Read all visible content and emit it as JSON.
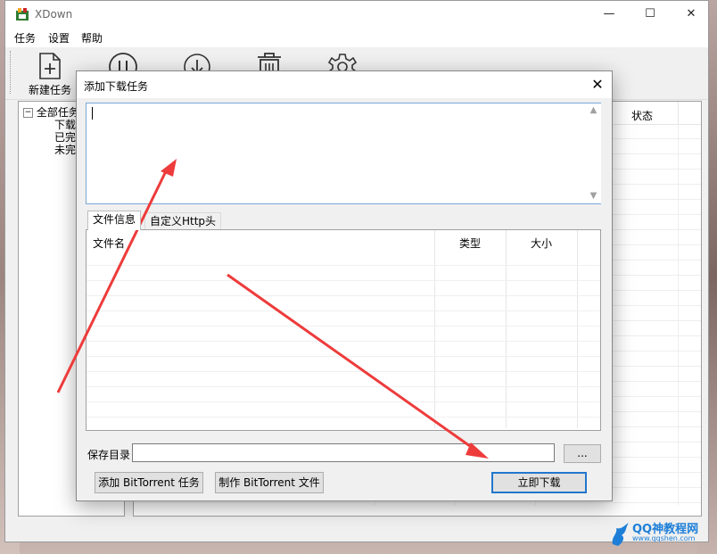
{
  "window": {
    "title": "XDown",
    "controls": {
      "minimize": "—",
      "maximize": "☐",
      "close": "✕"
    }
  },
  "menu": [
    "任务",
    "设置",
    "帮助"
  ],
  "toolbar": {
    "new_task_label": "新建任务"
  },
  "tree": {
    "root": "全部任务",
    "children": [
      "下载",
      "已完",
      "未完"
    ]
  },
  "list": {
    "status_header": "状态"
  },
  "dialog": {
    "title": "添加下载任务",
    "url_value": "",
    "tabs": [
      "文件信息",
      "自定义Http头"
    ],
    "file_columns": [
      "文件名",
      "类型",
      "大小"
    ],
    "save_dir_label": "保存目录",
    "save_dir_value": "",
    "browse_label": "...",
    "buttons": {
      "add_bt": "添加 BitTorrent 任务",
      "make_bt": "制作 BitTorrent 文件",
      "download_now": "立即下载"
    }
  },
  "watermark": {
    "text": "QQ神教程网",
    "sub": "www.qqshen.com"
  },
  "colors": {
    "accent": "#2277cc",
    "annotation": "#ee3b3b",
    "watermark": "#1d7fd8"
  }
}
